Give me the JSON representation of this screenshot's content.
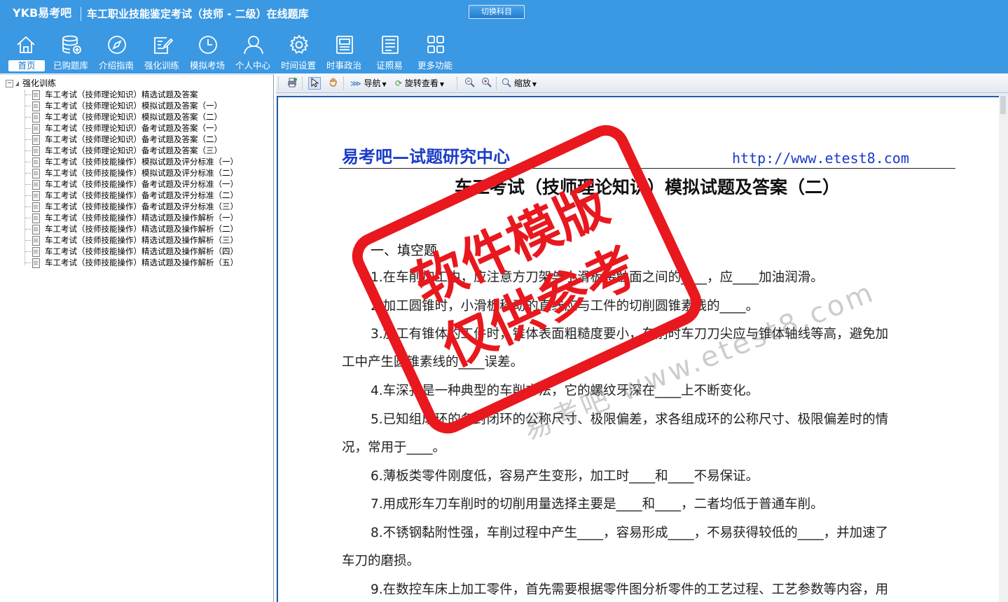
{
  "app": {
    "logo": "YKB易考吧",
    "title": "车工职业技能鉴定考试（技师 - 二级）在线题库",
    "switch_subject": "切换科目"
  },
  "toolbar": [
    {
      "label": "首页",
      "icon": "home-icon",
      "active": true
    },
    {
      "label": "已购题库",
      "icon": "database-icon"
    },
    {
      "label": "介绍指南",
      "icon": "compass-icon"
    },
    {
      "label": "强化训练",
      "icon": "edit-icon"
    },
    {
      "label": "模拟考场",
      "icon": "clock-icon"
    },
    {
      "label": "个人中心",
      "icon": "user-icon"
    },
    {
      "label": "时间设置",
      "icon": "gear-icon"
    },
    {
      "label": "时事政治",
      "icon": "news-icon"
    },
    {
      "label": "证照易",
      "icon": "certificate-icon"
    },
    {
      "label": "更多功能",
      "icon": "grid-icon"
    }
  ],
  "tree": {
    "expander": "−",
    "root": "强化训练",
    "items": [
      "车工考试（技师理论知识）精选试题及答案",
      "车工考试（技师理论知识）模拟试题及答案（一）",
      "车工考试（技师理论知识）模拟试题及答案（二）",
      "车工考试（技师理论知识）备考试题及答案（一）",
      "车工考试（技师理论知识）备考试题及答案（二）",
      "车工考试（技师理论知识）备考试题及答案（三）",
      "车工考试（技师技能操作）模拟试题及评分标准（一）",
      "车工考试（技师技能操作）模拟试题及评分标准（二）",
      "车工考试（技师技能操作）备考试题及评分标准（一）",
      "车工考试（技师技能操作）备考试题及评分标准（二）",
      "车工考试（技师技能操作）备考试题及评分标准（三）",
      "车工考试（技师技能操作）精选试题及操作解析（一）",
      "车工考试（技师技能操作）精选试题及操作解析（二）",
      "车工考试（技师技能操作）精选试题及操作解析（三）",
      "车工考试（技师技能操作）精选试题及操作解析（四）",
      "车工考试（技师技能操作）精选试题及操作解析（五）"
    ]
  },
  "viewer_toolbar": {
    "navigate": "导航",
    "rotate": "旋转查看",
    "zoom": "缩放"
  },
  "document": {
    "header_left": "易考吧—试题研究中心",
    "header_right": "http://www.etest8.com",
    "title": "车工考试（技师理论知识）模拟试题及答案（二）",
    "section": "一、填空题",
    "lines": [
      "1.在车削加工中，应注意方刀架与小滑板接触面之间的____，应____加油润滑。",
      "2.加工圆锥时，小滑板移动的直线应与工件的切削圆锥素线的____。",
      "3.加工有锥体的工件时，锥体表面粗糙度要小，车削时车刀刀尖应与锥体轴线等高，避免加",
      "工中产生圆锥素线的____误差。",
      "4.车深孔是一种典型的车削方法，它的螺纹牙深在____上不断变化。",
      "5.已知组成环的各封闭环的公称尺寸、极限偏差，求各组成环的公称尺寸、极限偏差时的情",
      "况，常用于____。",
      "6.薄板类零件刚度低，容易产生变形，加工时____和____不易保证。",
      "7.用成形车刀车削时的切削用量选择主要是____和____，二者均低于普通车削。",
      "8.不锈钢黏附性强，车削过程中产生____，容易形成____，不易获得较低的____，并加速了",
      "车刀的磨损。",
      "9.在数控车床上加工零件，首先需要根据零件图分析零件的工艺过程、工艺参数等内容，用"
    ]
  },
  "watermark": {
    "stamp_line1": "软件模版",
    "stamp_line2": "仅供参考",
    "url": "易考吧 www.etest8.com"
  }
}
